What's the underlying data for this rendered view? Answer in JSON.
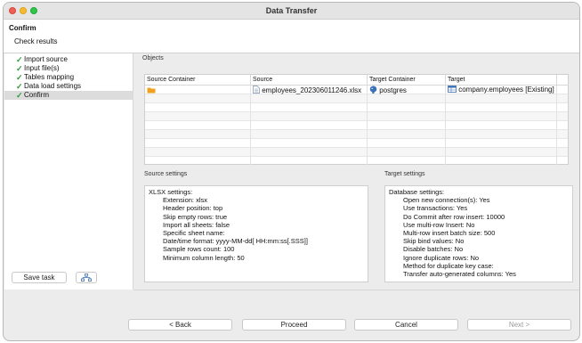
{
  "window": {
    "title": "Data Transfer"
  },
  "header": {
    "title": "Confirm",
    "subtitle": "Check results"
  },
  "steps": [
    {
      "label": "Import source",
      "done": true,
      "selected": false
    },
    {
      "label": "Input file(s)",
      "done": true,
      "selected": false
    },
    {
      "label": "Tables mapping",
      "done": true,
      "selected": false
    },
    {
      "label": "Data load settings",
      "done": true,
      "selected": false
    },
    {
      "label": "Confirm",
      "done": true,
      "selected": true
    }
  ],
  "left_buttons": {
    "save_task": "Save task"
  },
  "objects": {
    "label": "Objects",
    "columns": [
      "Source Container",
      "Source",
      "Target Container",
      "Target"
    ],
    "row": {
      "source": "employees_202306011246.xlsx",
      "target_container": "postgres",
      "target": "company.employees [Existing]"
    }
  },
  "source_settings": {
    "label": "Source settings",
    "heading": "XLSX settings:",
    "lines": [
      "Extension: xlsx",
      "Header position: top",
      "Skip empty rows: true",
      "Import all sheets: false",
      "Specific sheet name:",
      "Date/time format: yyyy-MM-dd[ HH:mm:ss[.SSS]]",
      "Sample rows count: 100",
      "Minimum column length: 50"
    ]
  },
  "target_settings": {
    "label": "Target settings",
    "heading": "Database settings:",
    "lines": [
      "Open new connection(s): Yes",
      "Use transactions: Yes",
      "Do Commit after row insert: 10000",
      "Use multi-row Insert: No",
      "Multi-row insert batch size: 500",
      "Skip bind values: No",
      "Disable batches: No",
      "Ignore duplicate rows: No",
      "Method for duplicate key case:",
      "Transfer auto-generated columns: Yes"
    ]
  },
  "nav_buttons": {
    "back": "< Back",
    "proceed": "Proceed",
    "cancel": "Cancel",
    "next": "Next >"
  },
  "colors": {
    "check": "#2f9a3a",
    "folder": "#f0a020",
    "db": "#3b6fb6"
  }
}
